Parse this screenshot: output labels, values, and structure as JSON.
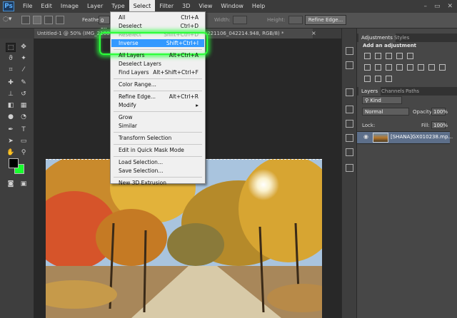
{
  "app": {
    "logo": "Ps"
  },
  "menubar": {
    "items": [
      "File",
      "Edit",
      "Image",
      "Layer",
      "Type",
      "Select",
      "Filter",
      "3D",
      "View",
      "Window",
      "Help"
    ],
    "active": "Select",
    "window_controls": [
      "–",
      "▭",
      "✕"
    ]
  },
  "options": {
    "feather_label": "Feather:",
    "feather_value": "0 px",
    "width_label": "Width:",
    "height_label": "Height:",
    "refine_edge_button": "Refine Edge..."
  },
  "document": {
    "tab_title": "Untitled-1 @ 50% (IMG_2106, RGB/8) ×   [SHANA]GX010238.mp4_20221106_042214.948, RGB/8) *",
    "close_glyph": "×"
  },
  "select_menu": {
    "groups": [
      [
        {
          "label": "All",
          "shortcut": "Ctrl+A",
          "state": "normal"
        },
        {
          "label": "Deselect",
          "shortcut": "Ctrl+D",
          "state": "normal"
        },
        {
          "label": "Reselect",
          "shortcut": "Shift+Ctrl+D",
          "state": "disabled"
        },
        {
          "label": "Inverse",
          "shortcut": "Shift+Ctrl+I",
          "state": "highlighted"
        }
      ],
      [
        {
          "label": "All Layers",
          "shortcut": "Alt+Ctrl+A",
          "state": "normal"
        },
        {
          "label": "Deselect Layers",
          "shortcut": "",
          "state": "normal"
        },
        {
          "label": "Find Layers",
          "shortcut": "Alt+Shift+Ctrl+F",
          "state": "normal"
        }
      ],
      [
        {
          "label": "Color Range...",
          "shortcut": "",
          "state": "normal"
        }
      ],
      [
        {
          "label": "Refine Edge...",
          "shortcut": "Alt+Ctrl+R",
          "state": "normal"
        },
        {
          "label": "Modify",
          "shortcut": "▸",
          "state": "normal"
        }
      ],
      [
        {
          "label": "Grow",
          "shortcut": "",
          "state": "normal"
        },
        {
          "label": "Similar",
          "shortcut": "",
          "state": "normal"
        }
      ],
      [
        {
          "label": "Transform Selection",
          "shortcut": "",
          "state": "normal"
        }
      ],
      [
        {
          "label": "Edit in Quick Mask Mode",
          "shortcut": "",
          "state": "normal"
        }
      ],
      [
        {
          "label": "Load Selection...",
          "shortcut": "",
          "state": "normal"
        },
        {
          "label": "Save Selection...",
          "shortcut": "",
          "state": "normal"
        }
      ],
      [
        {
          "label": "New 3D Extrusion",
          "shortcut": "",
          "state": "normal"
        }
      ]
    ]
  },
  "panels": {
    "top_tabs": [
      "Adjustments",
      "Styles"
    ],
    "adjustments_title": "Add an adjustment",
    "layer_tabs": [
      "Layers",
      "Channels",
      "Paths"
    ],
    "kind_label": "Kind",
    "blend_mode": "Normal",
    "opacity_label": "Opacity:",
    "opacity_value": "100%",
    "lock_label": "Lock:",
    "fill_label": "Fill:",
    "fill_value": "100%",
    "layer_name": "[SHANA]GX010238.mp...",
    "eye_glyph": "◉"
  },
  "colors": {
    "foreground": "#000000",
    "background": "#18ff2e",
    "highlight": "#3399ff",
    "glow": "#2cff3a"
  }
}
